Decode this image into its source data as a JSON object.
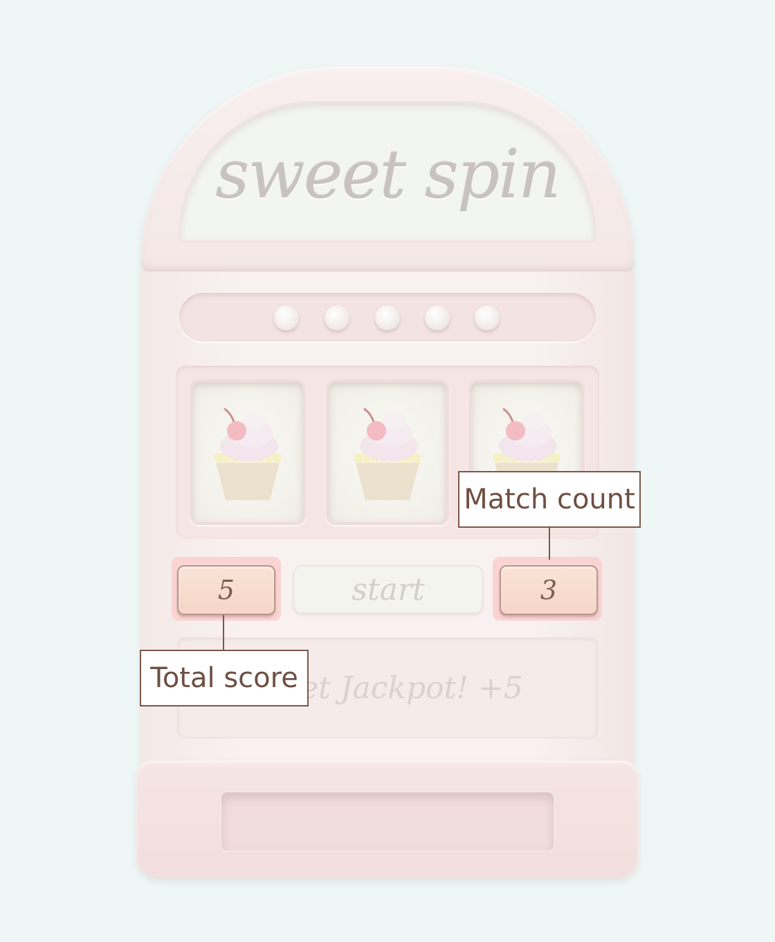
{
  "machine": {
    "title": "sweet spin",
    "start_label": "start",
    "message": "et Jackpot! +5",
    "total_score": "5",
    "match_count": "3",
    "indicator_lights": 5,
    "reels": [
      {
        "symbol": "cupcake-icon"
      },
      {
        "symbol": "cupcake-icon"
      },
      {
        "symbol": "cupcake-icon"
      }
    ]
  },
  "annotations": {
    "total_score_label": "Total score",
    "match_count_label": "Match count"
  },
  "colors": {
    "background": "#eef7f6",
    "cabinet": "#f8f1f0",
    "counter": "#f6d6c8",
    "counter_glow": "#f9d4d2",
    "annotation_border": "#7b5648",
    "annotation_text": "#6e4f43"
  }
}
